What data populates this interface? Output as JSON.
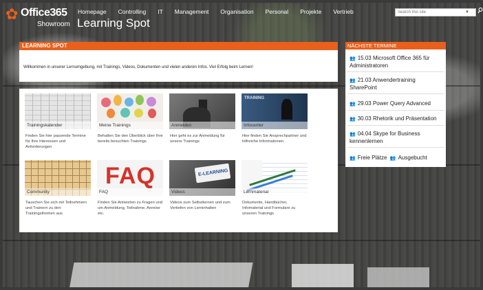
{
  "header": {
    "brand": "Office365",
    "brand_sub": "Showroom",
    "site_title": "Learning Spot",
    "nav": [
      "Homepage",
      "Controlling",
      "IT",
      "Management",
      "Organisation",
      "Personal",
      "Projekte",
      "Vertrieb"
    ],
    "search": {
      "placeholder": "Search this site"
    }
  },
  "main": {
    "heading": "LEARNING SPOT",
    "welcome": "Willkommen in unserer Lernumgebung, mit Trainings, Videos, Dokumenten und vielen anderen Infos. Viel Erfolg beim Lernen!",
    "tiles": [
      {
        "label": "Trainingskalender",
        "desc": "Finden Sie hier passende Termine für Ihre Interessen und Anforderungen"
      },
      {
        "label": "Meine Trainings",
        "desc": "Behalten Sie den Überblick über Ihre bereits besuchten Trainings"
      },
      {
        "label": "Anmelden",
        "desc": "Hier geht es zur Anmeldung für unsere Trainings"
      },
      {
        "label": "Infocenter",
        "desc": "Hier finden Sie Ansprechpartner und hilfreiche Informationen"
      },
      {
        "label": "Community",
        "desc": "Tauschen Sie sich mit Teilnehmern und Trainern zu den Trainingsthemen aus"
      },
      {
        "label": "FAQ",
        "desc": "Finden Sie Antworten zu Fragen und um Anmeldung, Teilnahme, Anreise etc."
      },
      {
        "label": "Videos",
        "desc": "Videos zum Selbstlernen und zum Vertiefen von Lerninhalten"
      },
      {
        "label": "Lernmaterial",
        "desc": "Dokumente, Handbücher, Infomaterial und Formulare zu unseren Trainings"
      }
    ],
    "tile_images": {
      "faq_text": "FAQ",
      "elearning_text": "E-LEARNING",
      "infocenter_text": "TRAINING"
    }
  },
  "side": {
    "heading": "NÄCHSTE TERMINE",
    "events": [
      {
        "text": "15.03 Microsoft Office 365 für Administratoren",
        "status": "green"
      },
      {
        "text": "21.03 Anwendertraining SharePoint",
        "status": "red"
      },
      {
        "text": "29.03 Power Query Advanced",
        "status": "green"
      },
      {
        "text": "30.03 Rhetorik und Präsentation",
        "status": "green"
      },
      {
        "text": "04.04 Skype for Business kennenlernen",
        "status": "green"
      }
    ],
    "legend_free": "Freie Plätze",
    "legend_booked": "Ausgebucht"
  },
  "colors": {
    "accent": "#e8601c",
    "free": "#3a9a3a",
    "booked": "#d0362b"
  }
}
